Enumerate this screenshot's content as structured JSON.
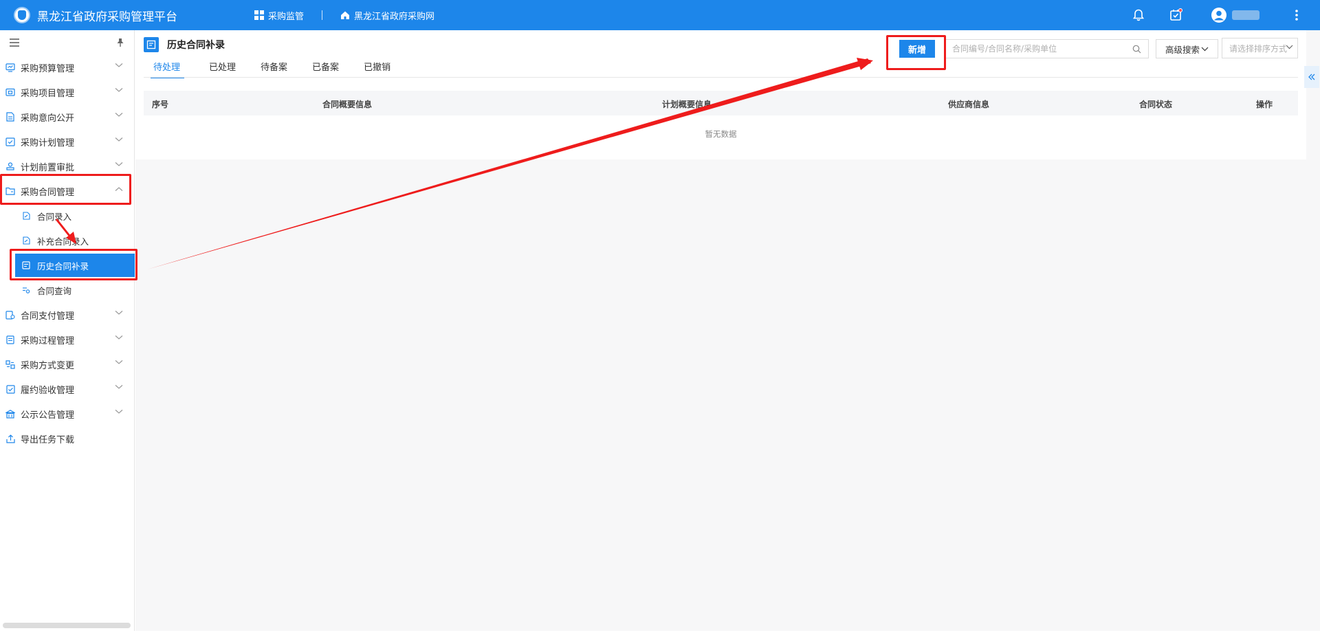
{
  "app": {
    "title": "黑龙江省政府采购管理平台",
    "nav_links": [
      {
        "label": "采购监管"
      },
      {
        "label": "黑龙江省政府采购网"
      }
    ]
  },
  "sidebar": {
    "items": [
      {
        "label": "采购预算管理"
      },
      {
        "label": "采购项目管理"
      },
      {
        "label": "采购意向公开"
      },
      {
        "label": "采购计划管理"
      },
      {
        "label": "计划前置审批"
      },
      {
        "label": "采购合同管理"
      },
      {
        "label": "合同支付管理"
      },
      {
        "label": "采购过程管理"
      },
      {
        "label": "采购方式变更"
      },
      {
        "label": "履约验收管理"
      },
      {
        "label": "公示公告管理"
      },
      {
        "label": "导出任务下载"
      }
    ],
    "sub_items": [
      {
        "label": "合同录入"
      },
      {
        "label": "补充合同录入"
      },
      {
        "label": "历史合同补录"
      },
      {
        "label": "合同查询"
      }
    ]
  },
  "page": {
    "title": "历史合同补录",
    "tabs": [
      {
        "label": "待处理"
      },
      {
        "label": "已处理"
      },
      {
        "label": "待备案"
      },
      {
        "label": "已备案"
      },
      {
        "label": "已撤销"
      }
    ],
    "new_button": "新增",
    "search_placeholder": "合同编号/合同名称/采购单位",
    "advanced_search": "高级搜索",
    "sort_placeholder": "请选择排序方式",
    "table": {
      "columns": [
        "序号",
        "合同概要信息",
        "计划概要信息",
        "供应商信息",
        "合同状态",
        "操作"
      ],
      "empty_text": "暂无数据"
    }
  },
  "colors": {
    "primary": "#1d86ea",
    "annotation_red": "#ee1c1c"
  }
}
